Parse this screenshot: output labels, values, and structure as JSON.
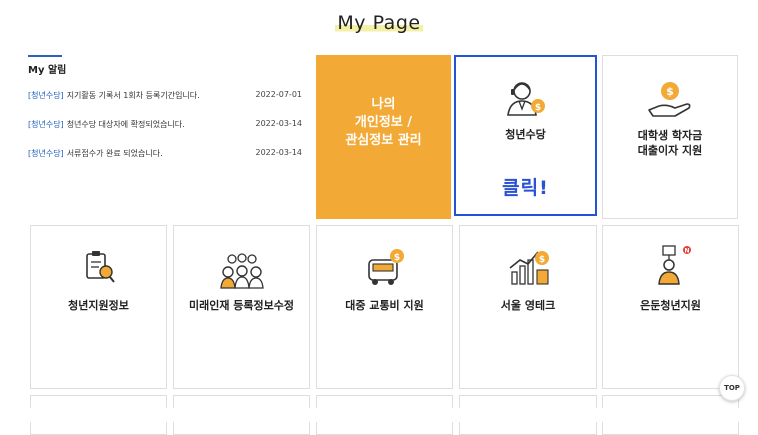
{
  "page": {
    "title": "My Page"
  },
  "notices": {
    "heading": "My 알림",
    "items": [
      {
        "category": "[청년수당]",
        "text": "지기활동 기록서 1회차 등록기간입니다.",
        "date": "2022-07-01"
      },
      {
        "category": "[청년수당]",
        "text": "청년수당 대상자에 확정되었습니다.",
        "date": "2022-03-14"
      },
      {
        "category": "[청년수당]",
        "text": "서류접수가 완료 되었습니다.",
        "date": "2022-03-14"
      }
    ]
  },
  "cards": {
    "personal": {
      "label": "나의\n개인정보 /\n관심정보 관리"
    },
    "youth_allowance": {
      "label": "청년수당",
      "click_label": "클릭!",
      "icon": "consultant-coin-icon"
    },
    "student_loan": {
      "label": "대학생 학자금\n대출이자 지원",
      "icon": "hand-coin-icon"
    },
    "youth_info": {
      "label": "청년지원정보",
      "icon": "clipboard-search-icon"
    },
    "future_talent": {
      "label": "미래인재 등록정보수정",
      "icon": "people-group-icon"
    },
    "transit": {
      "label": "대중 교통비 지원",
      "icon": "bus-coin-icon"
    },
    "seoul_youngtech": {
      "label": "서울 영테크",
      "icon": "growth-chart-coin-icon"
    },
    "reclusive_youth": {
      "label": "은둔청년지원",
      "icon": "person-sign-icon"
    }
  },
  "top_button": {
    "label": "TOP"
  },
  "colors": {
    "accent_orange": "#f2a936",
    "highlight_blue": "#2454d6",
    "link_blue": "#1f5fbf"
  }
}
